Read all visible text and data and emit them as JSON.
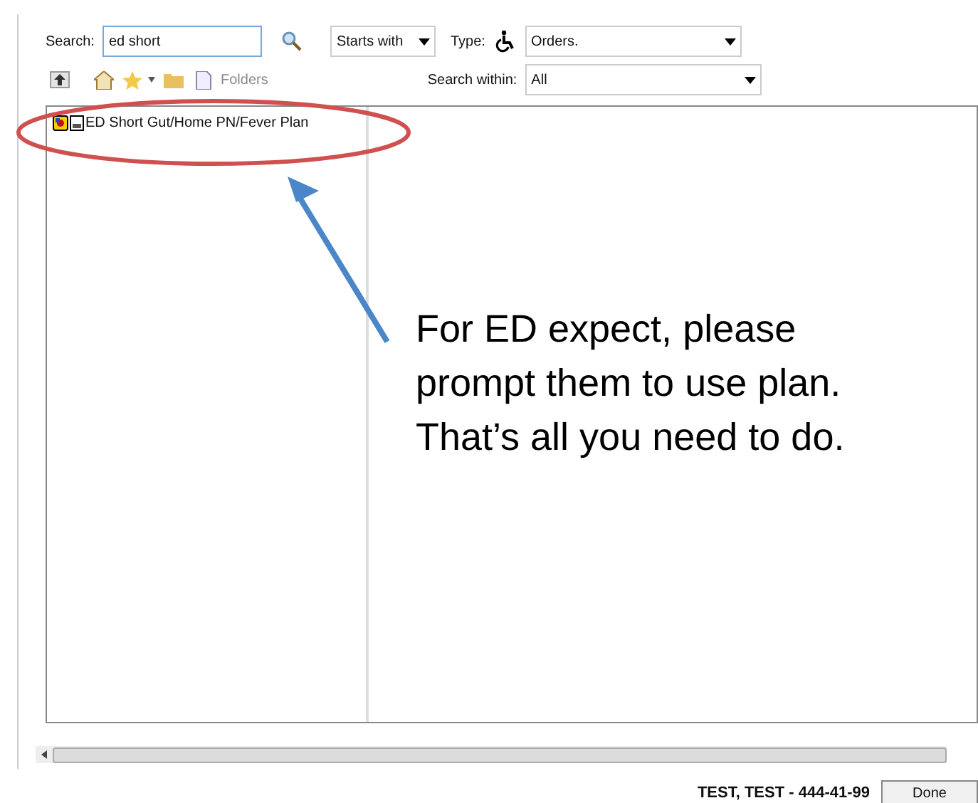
{
  "search": {
    "label": "Search:",
    "value": "ed short",
    "mode": "Starts with",
    "type_label": "Type:",
    "type_value": "Orders.",
    "within_label": "Search within:",
    "within_value": "All"
  },
  "toolbar": {
    "folders_label": "Folders",
    "folders_disabled": true
  },
  "tree": {
    "items": [
      {
        "label": "ED Short Gut/Home PN/Fever Plan"
      }
    ]
  },
  "annotation": {
    "lines": [
      "For ED expect, please",
      "prompt them to use plan.",
      "That’s all you need to do."
    ]
  },
  "status_bar": {
    "patient": "TEST, TEST - 444-41-99",
    "button": "Done"
  }
}
